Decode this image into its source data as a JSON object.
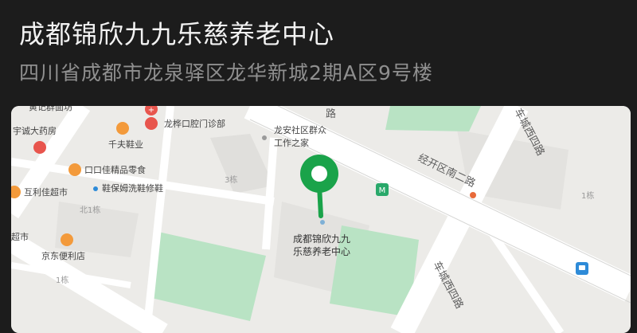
{
  "place": {
    "name": "成都锦欣九九乐慈养老中心",
    "address": "四川省成都市龙泉驿区龙华新城2期A区9号楼"
  },
  "map": {
    "colors": {
      "background": "#1c1c1c",
      "title_text": "#f2f2f2",
      "address_text": "#8f8f8f",
      "map_base": "#ecebe8",
      "road": "#ffffff",
      "green_area": "#b9e3c4",
      "pin": "#1aa34a",
      "poi_orange": "#f39a3b",
      "poi_red": "#e8554d",
      "transit_blue": "#2e8bd8",
      "metro_green": "#29a86a"
    },
    "pin_label_line1": "成都锦欣九九",
    "pin_label_line2": "乐慈养老中心",
    "pin_icon": "map-pin-icon",
    "roads": {
      "road_a": "经开区南二路",
      "road_a_top": "路",
      "road_b": "车城西四路",
      "road_c": "车城西四路"
    },
    "pois": {
      "poi_1": "龙桦口腔门诊部",
      "poi_2": "千夫鞋业",
      "poi_3": "宇诚大药房",
      "poi_4": "口口佳精品零食",
      "poi_5": "鞋保姆洗鞋修鞋",
      "poi_6": "互利佳超市",
      "poi_7": "超市",
      "poi_8": "京东便利店",
      "poi_9_line1": "龙安社区群众",
      "poi_9_line2": "工作之家",
      "poi_10": "黄记群面坊"
    },
    "buildings": {
      "bldg_3": "3栋",
      "bldg_north1": "北1栋",
      "bldg_1a": "1栋",
      "bldg_1b": "1栋"
    }
  }
}
